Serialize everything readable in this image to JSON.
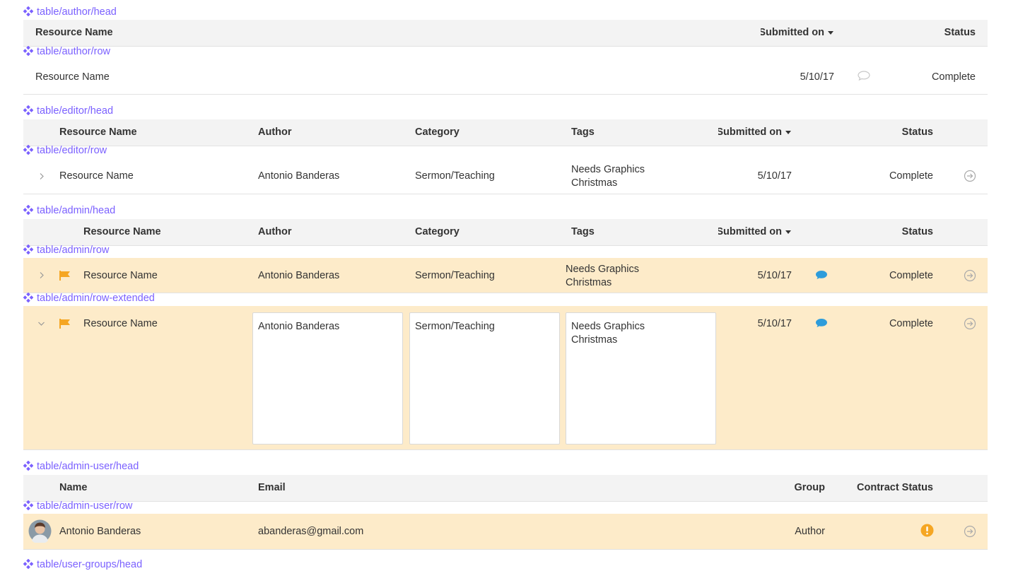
{
  "colors": {
    "accent": "#7b61ff",
    "highlight_row": "#fdebc9",
    "flag": "#f5a623",
    "comment": "#2d9cdb",
    "warning": "#f5a623"
  },
  "author_head": {
    "label": "table/author/head",
    "col_name": "Resource Name",
    "col_submitted": "Submitted on",
    "col_status": "Status"
  },
  "author_row": {
    "label": "table/author/row",
    "name": "Resource Name",
    "date": "5/10/17",
    "status": "Complete",
    "comment_icon": "comment-outline-icon"
  },
  "editor_head": {
    "label": "table/editor/head",
    "col_name": "Resource Name",
    "col_author": "Author",
    "col_category": "Category",
    "col_tags": "Tags",
    "col_submitted": "Submitted on",
    "col_status": "Status"
  },
  "editor_row": {
    "label": "table/editor/row",
    "name": "Resource Name",
    "author": "Antonio Banderas",
    "category": "Sermon/Teaching",
    "tags": [
      "Needs Graphics",
      "Christmas"
    ],
    "date": "5/10/17",
    "status": "Complete"
  },
  "admin_head": {
    "label": "table/admin/head",
    "col_name": "Resource Name",
    "col_author": "Author",
    "col_category": "Category",
    "col_tags": "Tags",
    "col_submitted": "Submitted on",
    "col_status": "Status"
  },
  "admin_row": {
    "label": "table/admin/row",
    "name": "Resource Name",
    "author": "Antonio Banderas",
    "category": "Sermon/Teaching",
    "tags": [
      "Needs Graphics",
      "Christmas"
    ],
    "date": "5/10/17",
    "status": "Complete"
  },
  "admin_row_extended": {
    "label": "table/admin/row-extended",
    "name": "Resource Name",
    "author": "Antonio Banderas",
    "category": "Sermon/Teaching",
    "tags": [
      "Needs Graphics",
      "Christmas"
    ],
    "date": "5/10/17",
    "status": "Complete"
  },
  "admin_user_head": {
    "label": "table/admin-user/head",
    "col_name": "Name",
    "col_email": "Email",
    "col_group": "Group",
    "col_contract": "Contract Status"
  },
  "admin_user_row": {
    "label": "table/admin-user/row",
    "name": "Antonio Banderas",
    "email": "abanderas@gmail.com",
    "group": "Author"
  },
  "user_groups_head": {
    "label": "table/user-groups/head"
  }
}
